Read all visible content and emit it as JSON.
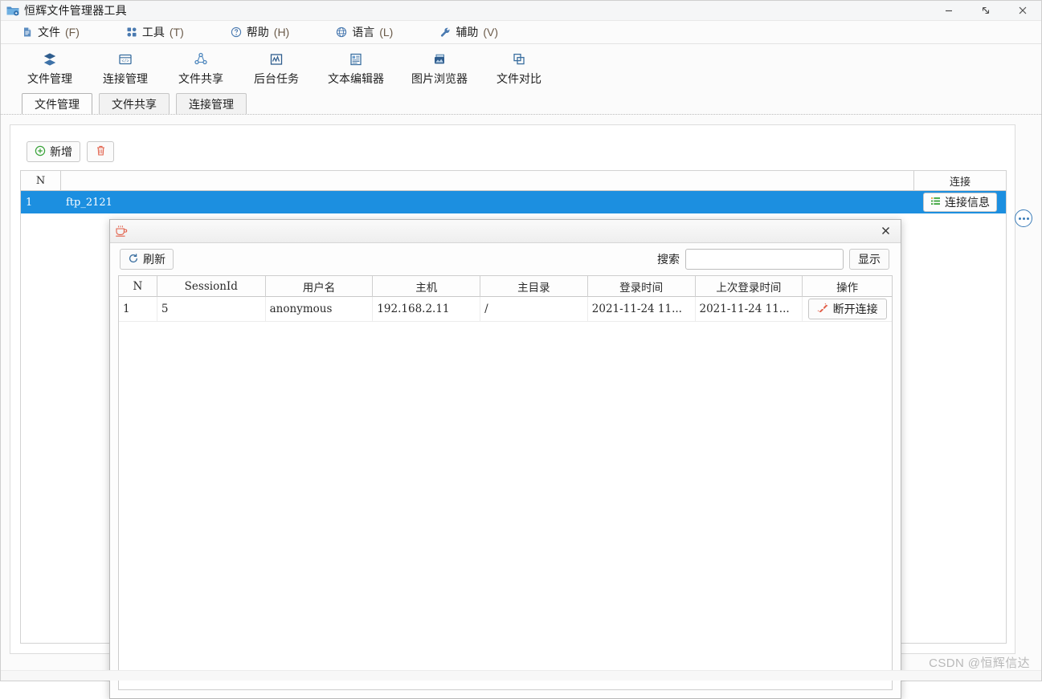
{
  "window": {
    "title": "恒辉文件管理器工具",
    "icon": "folder-app-icon",
    "minimize": "—",
    "restore": "⤢",
    "close": "✕"
  },
  "menubar": {
    "items": [
      {
        "label": "文件",
        "key": "(F)",
        "icon": "file-icon"
      },
      {
        "label": "工具",
        "key": "(T)",
        "icon": "grid-tools-icon"
      },
      {
        "label": "帮助",
        "key": "(H)",
        "icon": "question-circle-icon"
      },
      {
        "label": "语言",
        "key": "(L)",
        "icon": "globe-icon"
      },
      {
        "label": "辅助",
        "key": "(V)",
        "icon": "wrench-icon"
      }
    ]
  },
  "toolbar": {
    "items": [
      {
        "label": "文件管理",
        "icon": "layers-icon"
      },
      {
        "label": "连接管理",
        "icon": "code-window-icon"
      },
      {
        "label": "文件共享",
        "icon": "share-icon"
      },
      {
        "label": "后台任务",
        "icon": "chart-activity-icon"
      },
      {
        "label": "文本编辑器",
        "icon": "text-document-icon"
      },
      {
        "label": "图片浏览器",
        "icon": "image-stack-icon"
      },
      {
        "label": "文件对比",
        "icon": "compare-windows-icon"
      }
    ]
  },
  "tabs": [
    {
      "label": "文件管理",
      "active": true
    },
    {
      "label": "文件共享",
      "active": false
    },
    {
      "label": "连接管理",
      "active": false
    }
  ],
  "background_panel": {
    "buttons": [
      {
        "label": "新增",
        "icon": "plus-circle-icon"
      },
      {
        "label": "",
        "icon": "trash-icon"
      }
    ],
    "columns": [
      "N",
      "",
      "连接"
    ],
    "rows": [
      {
        "n": "1",
        "name": "ftp_2121",
        "action": "连接信息",
        "action_icon": "list-icon",
        "selected": true
      }
    ]
  },
  "dialog": {
    "icon": "coffee-cup-icon",
    "close": "✕",
    "refresh_button": {
      "label": "刷新",
      "icon": "refresh-icon"
    },
    "search": {
      "label": "搜索",
      "value": "",
      "placeholder": ""
    },
    "show_button": "显示",
    "columns": [
      "N",
      "SessionId",
      "用户名",
      "主机",
      "主目录",
      "登录时间",
      "上次登录时间",
      "操作"
    ],
    "rows": [
      {
        "n": "1",
        "session_id": "5",
        "user": "anonymous",
        "host": "192.168.2.11",
        "home": "/",
        "login_time": "2021-11-24 11...",
        "last_login_time": "2021-11-24 11...",
        "action": "断开连接",
        "action_icon": "disconnect-icon"
      }
    ]
  },
  "overlay": {
    "more_icon": "more-ellipsis-circle-icon"
  },
  "watermark": "CSDN @恒辉信达",
  "colors": {
    "accent": "#1c8fe0",
    "icon_blue": "#3b6fa0",
    "green": "#3aa33a",
    "red": "#e2604a",
    "titlebar": "#f5f6f7"
  }
}
